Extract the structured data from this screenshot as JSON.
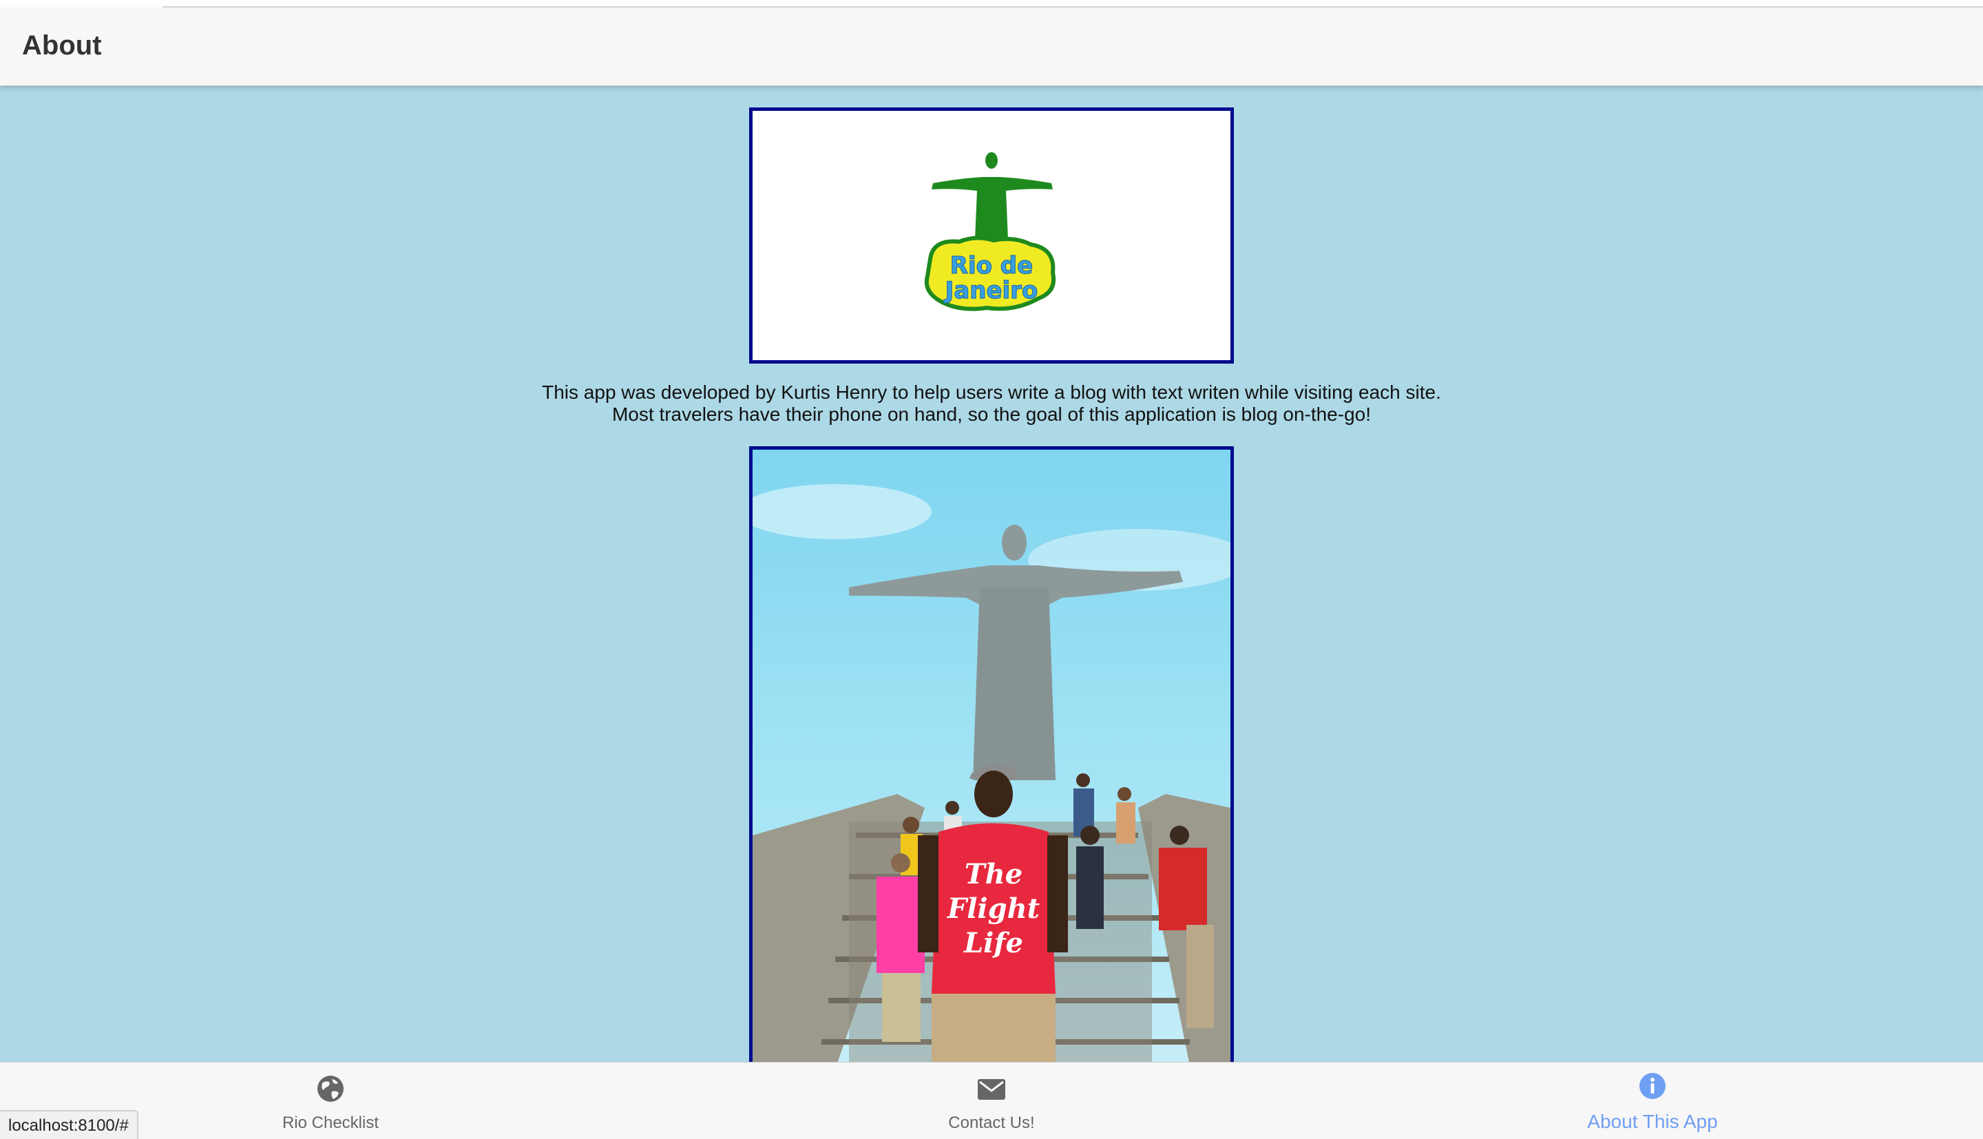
{
  "header": {
    "title": "About"
  },
  "main": {
    "logo": {
      "alt": "Rio de Janeiro logo",
      "text": "Rio de Janeiro"
    },
    "description": [
      "This app was developed by Kurtis Henry to help users write a blog with text writen while visiting each site.",
      "Most travelers have their phone on hand, so the goal of this application is blog on-the-go!"
    ],
    "photo": {
      "alt": "Photo at Christ the Redeemer",
      "shirt_text": "The Flight Life"
    }
  },
  "tabs": [
    {
      "label": "Rio Checklist",
      "icon": "globe-icon",
      "active": false
    },
    {
      "label": "Contact Us!",
      "icon": "mail-icon",
      "active": false
    },
    {
      "label": "About This App",
      "icon": "info-icon",
      "active": true
    }
  ],
  "status_bar": {
    "url": "localhost:8100/#"
  },
  "colors": {
    "background": "#add8e6",
    "frame_border": "#000c8f",
    "active_tab": "#6f9ff2",
    "inactive_tab": "#666666",
    "logo_green": "#1e8a1e",
    "logo_yellow": "#f0ea23",
    "logo_blue": "#3aa0e0"
  }
}
